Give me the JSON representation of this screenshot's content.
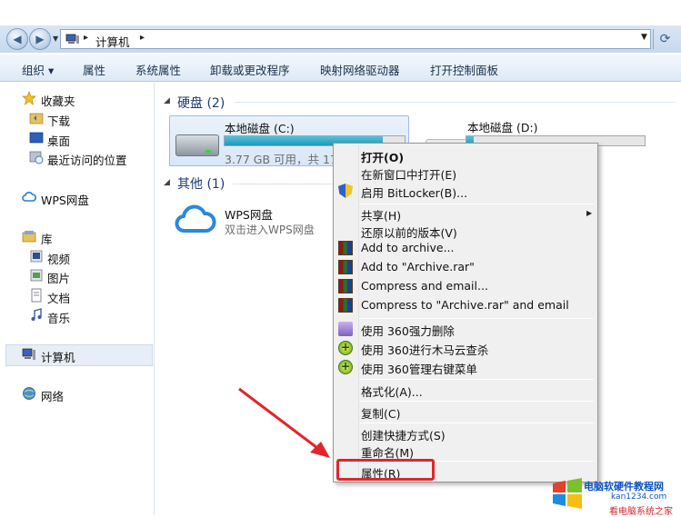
{
  "address": {
    "path": "计算机"
  },
  "toolbar": {
    "organize": "组织 ▾",
    "properties": "属性",
    "system_properties": "系统属性",
    "uninstall": "卸载或更改程序",
    "map_drive": "映射网络驱动器",
    "control_panel": "打开控制面板"
  },
  "sidebar": {
    "favorites": "收藏夹",
    "downloads": "下载",
    "desktop": "桌面",
    "recent": "最近访问的位置",
    "wps_drive": "WPS网盘",
    "libraries": "库",
    "videos": "视频",
    "pictures": "图片",
    "documents": "文档",
    "music": "音乐",
    "computer": "计算机",
    "network": "网络"
  },
  "main": {
    "hard_disks_header": "硬盘 (2)",
    "drive_c": {
      "name": "本地磁盘 (C:)",
      "free": "3.77 GB 可用，共 17",
      "usage": 0.88
    },
    "drive_d": {
      "name": "本地磁盘 (D:)",
      "usage": 0.04
    },
    "other_header": "其他 (1)",
    "wps": {
      "title": "WPS网盘",
      "subtitle": "双击进入WPS网盘"
    }
  },
  "context_menu": {
    "open": "打开(O)",
    "open_new_window": "在新窗口中打开(E)",
    "bitlocker": "启用 BitLocker(B)...",
    "share": "共享(H)",
    "restore": "还原以前的版本(V)",
    "add_archive": "Add to archive...",
    "add_archive_rar": "Add to \"Archive.rar\"",
    "compress_email": "Compress and email...",
    "compress_rar_email": "Compress to \"Archive.rar\" and email",
    "shred_360": "使用 360强力删除",
    "scan_360": "使用 360进行木马云查杀",
    "manage_360": "使用 360管理右键菜单",
    "format": "格式化(A)...",
    "copy": "复制(C)",
    "create_shortcut": "创建快捷方式(S)",
    "rename": "重命名(M)",
    "properties": "属性(R)"
  },
  "watermark": {
    "line1": "电脑软硬件教程网",
    "line2": "kan1234.com",
    "line3": "看电脑系统之家"
  },
  "colors": {
    "accent": "#1e3a72",
    "highlight": "#e0262b",
    "bar": "#1e98b8"
  }
}
